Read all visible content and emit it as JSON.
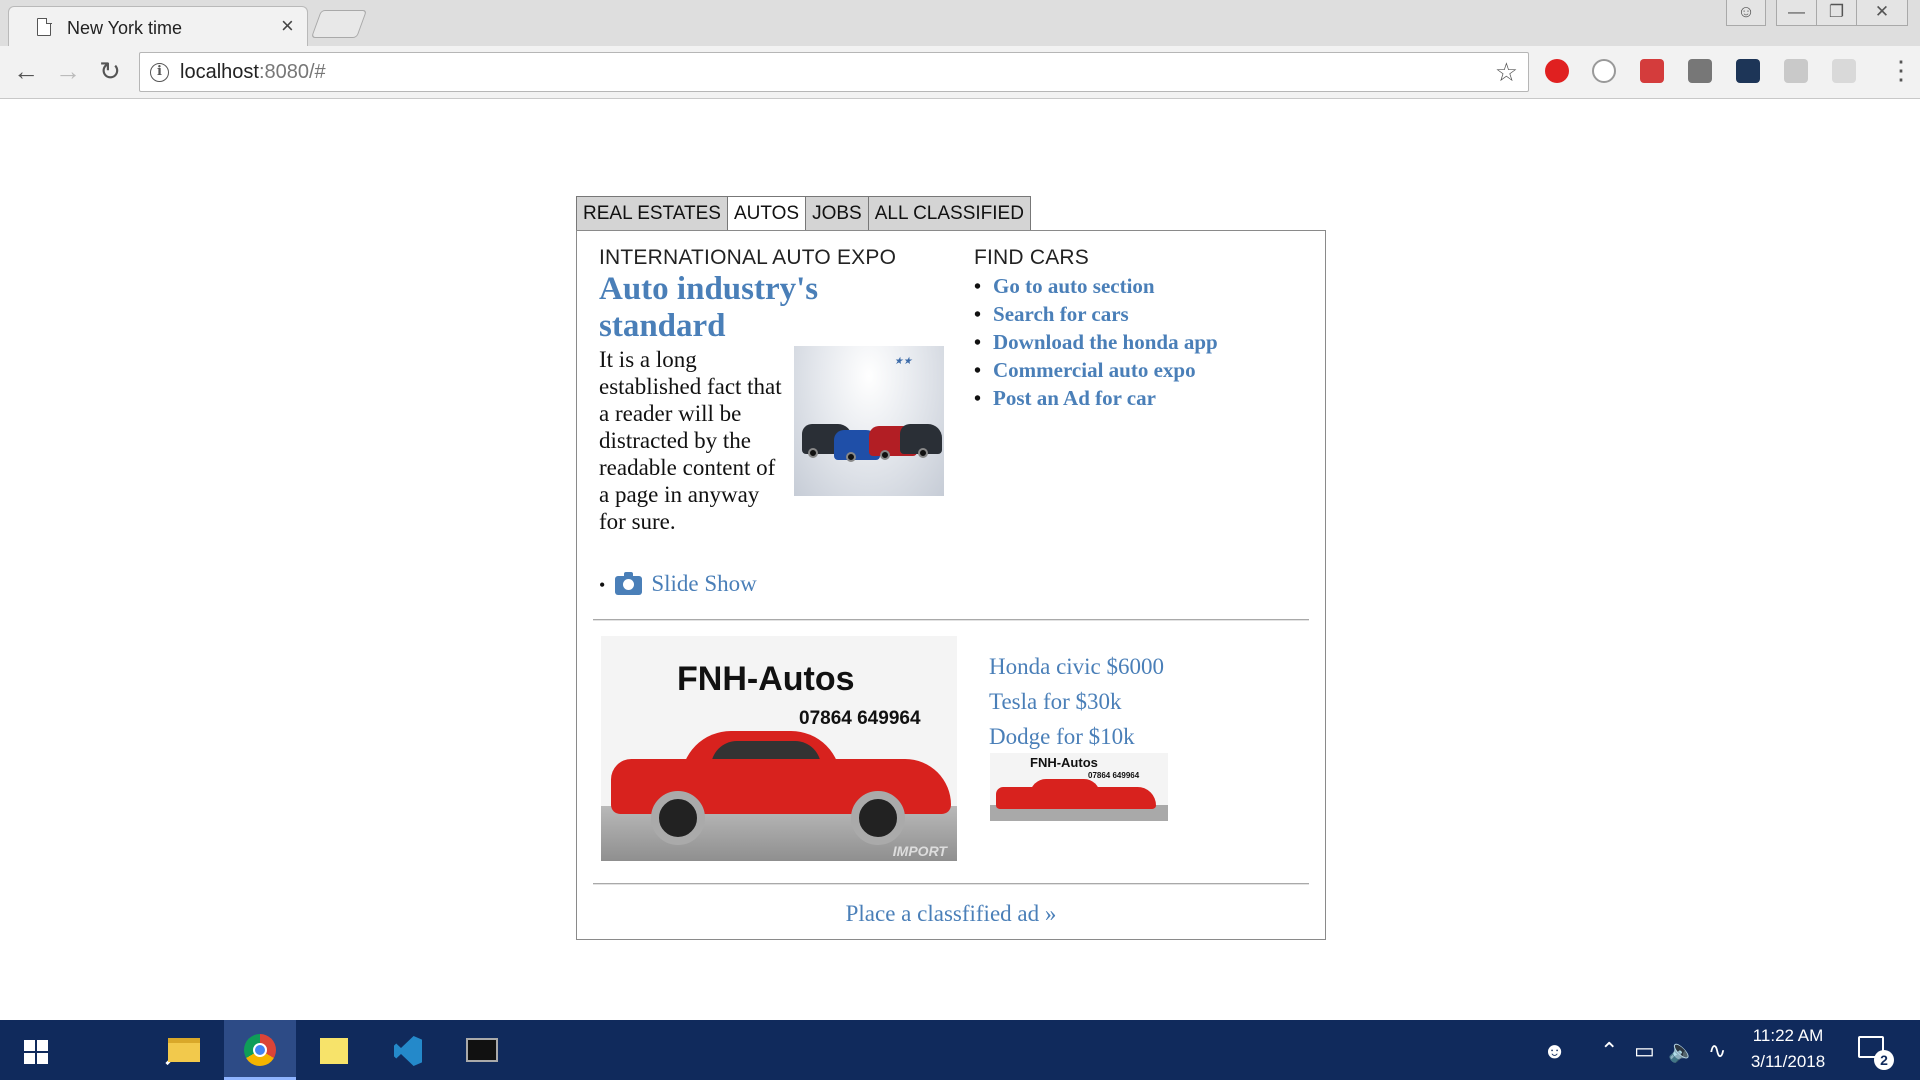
{
  "browser": {
    "tab_title": "New York time",
    "tab_close": "×",
    "url_host": "localhost",
    "url_rest": ":8080/#",
    "window_controls": [
      "👤",
      "▭",
      "⧉",
      "✕"
    ]
  },
  "content_tabs": [
    "REAL ESTATES",
    "AUTOS",
    "JOBS",
    "ALL CLASSIFIED"
  ],
  "active_tab": "AUTOS",
  "expo": {
    "heading": "INTERNATIONAL AUTO EXPO",
    "headline": "Auto industry's standard",
    "body": "It is a long established fact that a reader will be distracted by the readable content of a page in anyway for sure.",
    "slideshow_label": "Slide Show"
  },
  "find_cars": {
    "heading": "FIND CARS",
    "links": [
      "Go to auto section",
      "Search for cars",
      "Download the honda app",
      "Commercial auto expo",
      "Post an Ad for car"
    ]
  },
  "ad": {
    "title": "FNH-Autos",
    "phone": "07864 649964",
    "deals": [
      "Honda civic $6000",
      "Tesla for $30k",
      "Dodge for $10k"
    ]
  },
  "place_ad_link": "Place a classfified ad »",
  "taskbar": {
    "time": "11:22 AM",
    "date": "3/11/2018",
    "notification_count": "2"
  },
  "colors": {
    "link": "#4a7fb8",
    "taskbar": "#102a5c",
    "tab_inactive": "#d4d4d4"
  }
}
